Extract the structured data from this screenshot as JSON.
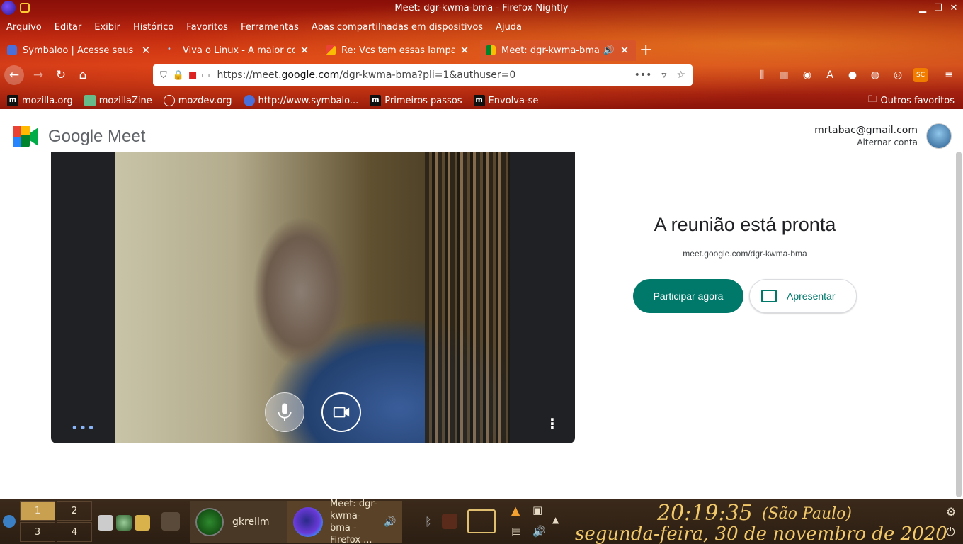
{
  "window": {
    "title": "Meet: dgr-kwma-bma - Firefox Nightly"
  },
  "menu": [
    "Arquivo",
    "Editar",
    "Exibir",
    "Histórico",
    "Favoritos",
    "Ferramentas",
    "Abas compartilhadas em dispositivos",
    "Ajuda"
  ],
  "tabs": [
    {
      "label": "Symbaloo | Acesse seus fa",
      "close": "✕"
    },
    {
      "label": "Viva o Linux - A maior com",
      "close": "✕"
    },
    {
      "label": "Re: Vcs tem essas lampada",
      "close": "✕"
    },
    {
      "label": "Meet: dgr-kwma-bma",
      "close": "✕"
    }
  ],
  "newtab": "+",
  "url": {
    "prefix": "https://meet.",
    "domain": "google.com",
    "path": "/dgr-kwma-bma?pli=1&authuser=0"
  },
  "bookmarks": [
    "mozilla.org",
    "mozillaZine",
    "mozdev.org",
    "http://www.symbalo...",
    "Primeiros passos",
    "Envolva-se"
  ],
  "bookmarks_other": "Outros favoritos",
  "meet": {
    "brand": "Google Meet",
    "account_email": "mrtabac@gmail.com",
    "account_switch": "Alternar conta",
    "heading": "A reunião está pronta",
    "meeting_link": "meet.google.com/dgr-kwma-bma",
    "join_label": "Participar agora",
    "present_label": "Apresentar",
    "more_dots": "•••",
    "more_vert": "⋮"
  },
  "taskbar": {
    "pager": [
      "1",
      "2",
      "3",
      "4"
    ],
    "gkrellm": "gkrellm",
    "firefox_task": "Meet: dgr-kwma-bma - Firefox ...",
    "time": "20:19:35",
    "timezone": "(São Paulo)",
    "date": "segunda-feira, 30 de novembro de 2020"
  },
  "colors": {
    "accent": "#00796b",
    "clock": "#f2c96a"
  }
}
